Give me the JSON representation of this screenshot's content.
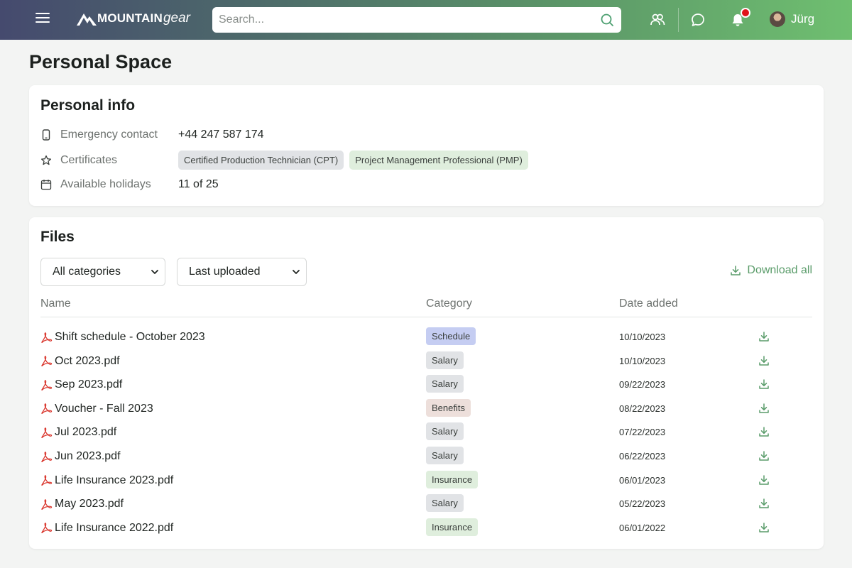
{
  "colors": {
    "accent": "#5a9c6a",
    "notification": "#e0141a",
    "schedule": "#c5cdf2",
    "salary": "#e1e3e6",
    "benefits": "#eddfdb",
    "insurance": "#dfeedd",
    "pdf": "#d9342b"
  },
  "header": {
    "logo_brand": "MOUNTAIN",
    "logo_suffix": "gear",
    "search_placeholder": "Search...",
    "icons": [
      "menu-icon",
      "team-icon",
      "chat-icon",
      "bell-icon",
      "search-icon"
    ],
    "user_name": "Jürg"
  },
  "page": {
    "title": "Personal Space"
  },
  "personal_info": {
    "title": "Personal info",
    "emergency_label": "Emergency contact",
    "emergency_value": "+44 247 587 174",
    "certificates_label": "Certificates",
    "certificates": [
      "Certified Production Technician (CPT)",
      "Project Management Professional (PMP)"
    ],
    "holidays_label": "Available holidays",
    "holidays_value": "11 of 25"
  },
  "files": {
    "title": "Files",
    "filter_category": "All categories",
    "filter_sort": "Last uploaded",
    "download_all": "Download all",
    "columns": [
      "Name",
      "Category",
      "Date added"
    ],
    "rows": [
      {
        "name": "Shift schedule - October 2023",
        "category": "Schedule",
        "date": "10/10/2023"
      },
      {
        "name": "Oct 2023.pdf",
        "category": "Salary",
        "date": "10/10/2023"
      },
      {
        "name": "Sep 2023.pdf",
        "category": "Salary",
        "date": "09/22/2023"
      },
      {
        "name": "Voucher - Fall 2023",
        "category": "Benefits",
        "date": "08/22/2023"
      },
      {
        "name": "Jul 2023.pdf",
        "category": "Salary",
        "date": "07/22/2023"
      },
      {
        "name": "Jun 2023.pdf",
        "category": "Salary",
        "date": "06/22/2023"
      },
      {
        "name": "Life Insurance 2023.pdf",
        "category": "Insurance",
        "date": "06/01/2023"
      },
      {
        "name": "May 2023.pdf",
        "category": "Salary",
        "date": "05/22/2023"
      },
      {
        "name": "Life Insurance 2022.pdf",
        "category": "Insurance",
        "date": "06/01/2022"
      }
    ]
  }
}
